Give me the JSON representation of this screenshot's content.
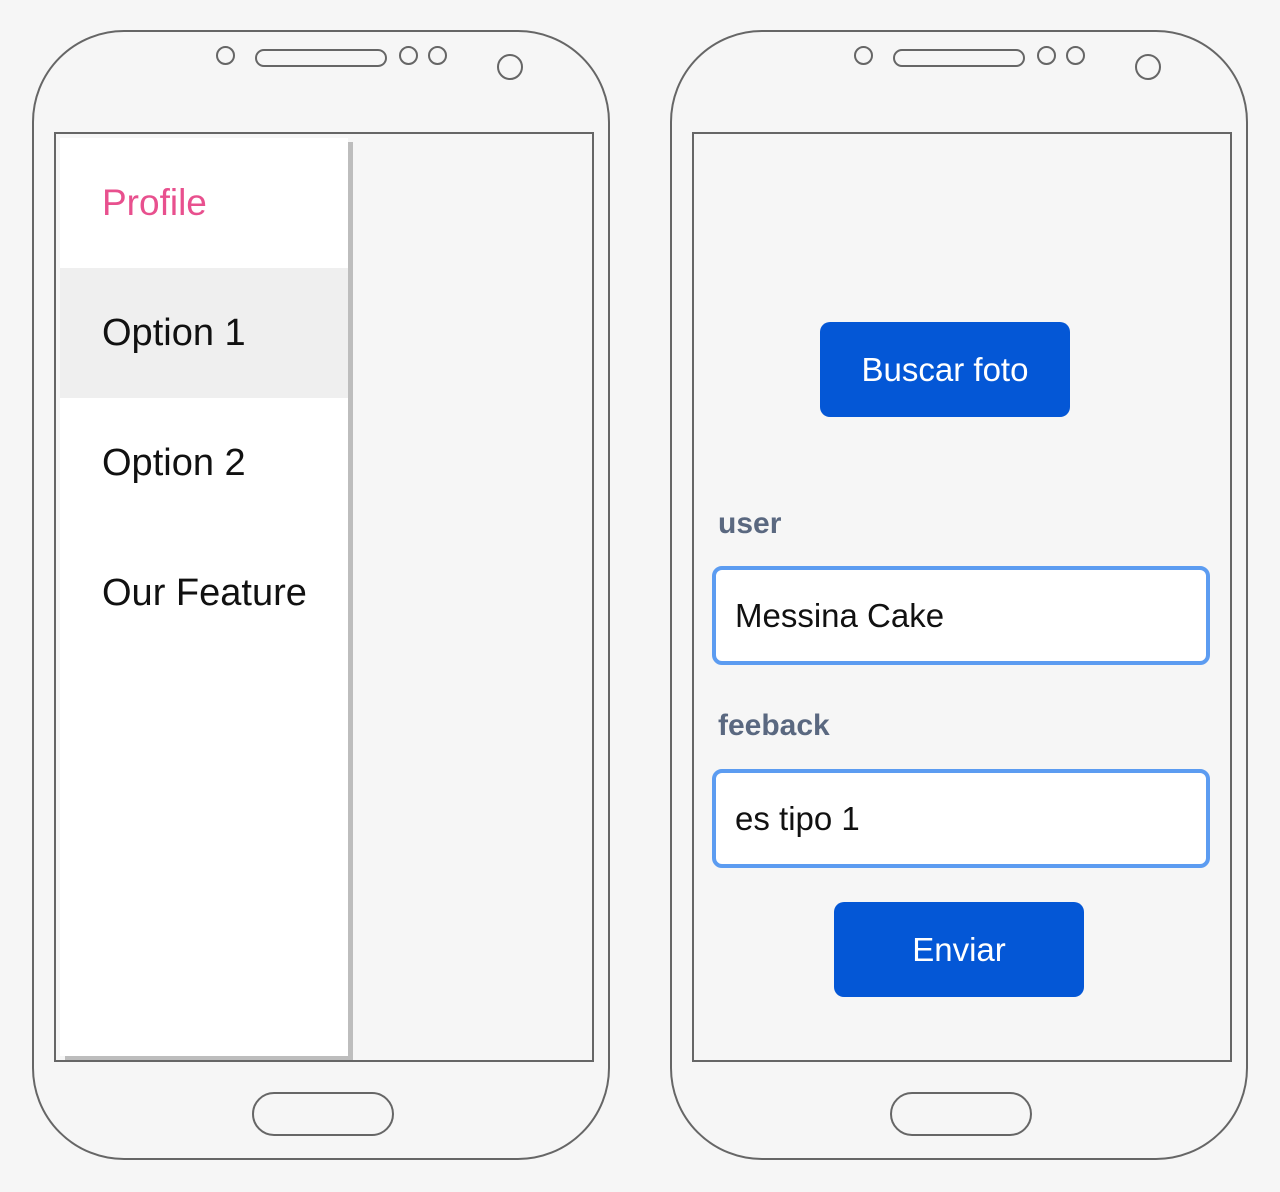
{
  "left_phone": {
    "drawer": {
      "items": [
        {
          "label": "Profile",
          "style": "header",
          "color": "#e8508e"
        },
        {
          "label": "Option 1",
          "style": "selected"
        },
        {
          "label": "Option 2",
          "style": "normal"
        },
        {
          "label": "Our Feature",
          "style": "normal"
        }
      ]
    }
  },
  "right_phone": {
    "form": {
      "photo_button_label": "Buscar foto",
      "user_label": "user",
      "user_value": "Messina Cake",
      "feedback_label": "feeback",
      "feedback_value": "es tipo 1",
      "submit_button_label": "Enviar"
    }
  },
  "colors": {
    "primary_button": "#0457d6",
    "input_border": "#5c9cf1",
    "profile_accent": "#e8508e",
    "label_text": "#5a6880"
  }
}
